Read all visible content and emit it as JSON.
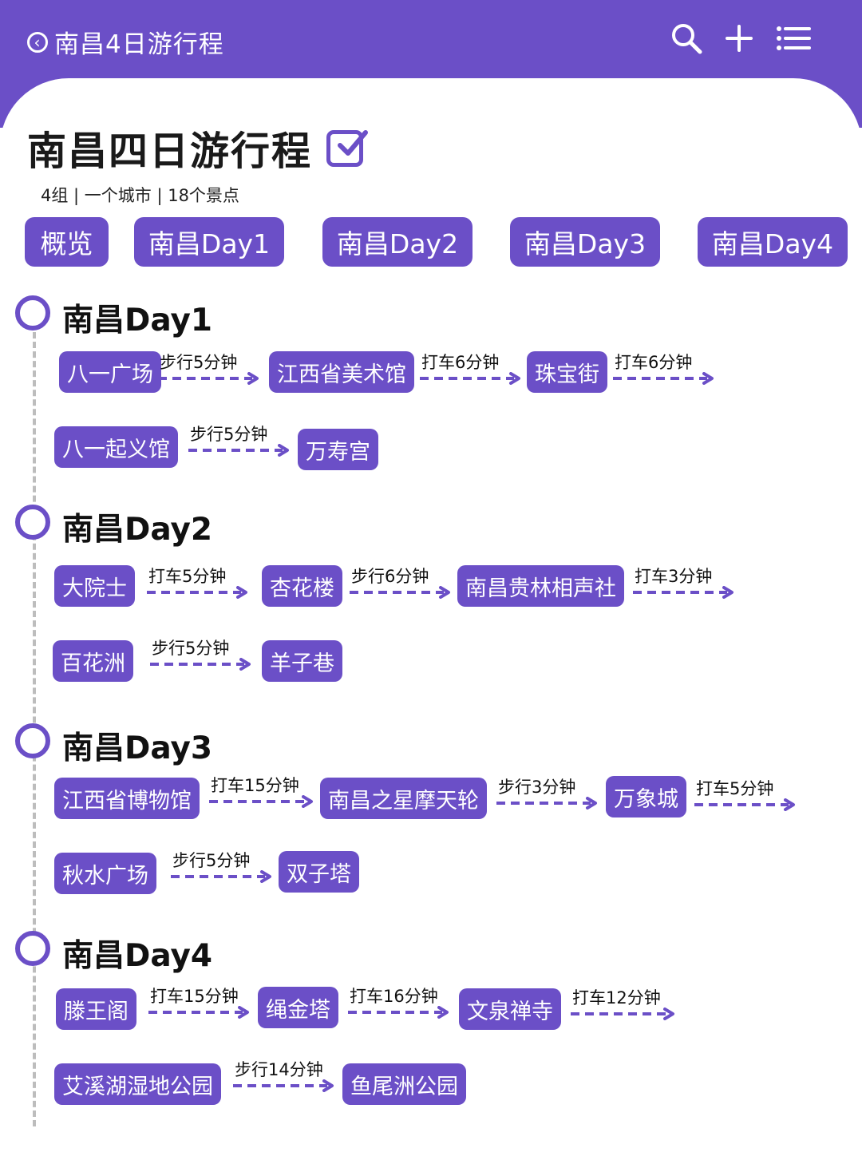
{
  "header": {
    "back_title": "南昌4日游行程",
    "icons": [
      "back-icon",
      "search-icon",
      "add-icon",
      "menu-list-icon"
    ]
  },
  "page": {
    "title": "南昌四日游行程",
    "stats": "4组 | 一个城市 | 18个景点",
    "title_icon": "checkbox-icon"
  },
  "tabs": [
    "概览",
    "南昌Day1",
    "南昌Day2",
    "南昌Day3",
    "南昌Day4"
  ],
  "days": [
    {
      "title": "南昌Day1",
      "rows": [
        [
          {
            "place": "八一广场",
            "link": "步行5分钟"
          },
          {
            "place": "江西省美术馆",
            "link": "打车6分钟"
          },
          {
            "place": "珠宝街",
            "link": "打车6分钟"
          }
        ],
        [
          {
            "place": "八一起义馆",
            "link": "步行5分钟"
          },
          {
            "place": "万寿宫",
            "link": ""
          }
        ]
      ]
    },
    {
      "title": "南昌Day2",
      "rows": [
        [
          {
            "place": "大院士",
            "link": "打车5分钟"
          },
          {
            "place": "杏花楼",
            "link": "步行6分钟"
          },
          {
            "place": "南昌贵林相声社",
            "link": "打车3分钟"
          }
        ],
        [
          {
            "place": "百花洲",
            "link": "步行5分钟"
          },
          {
            "place": "羊子巷",
            "link": ""
          }
        ]
      ]
    },
    {
      "title": "南昌Day3",
      "rows": [
        [
          {
            "place": "江西省博物馆",
            "link": "打车15分钟"
          },
          {
            "place": "南昌之星摩天轮",
            "link": "步行3分钟"
          },
          {
            "place": "万象城",
            "link": "打车5分钟"
          }
        ],
        [
          {
            "place": "秋水广场",
            "link": "步行5分钟"
          },
          {
            "place": "双子塔",
            "link": ""
          }
        ]
      ]
    },
    {
      "title": "南昌Day4",
      "rows": [
        [
          {
            "place": "滕王阁",
            "link": "打车15分钟"
          },
          {
            "place": "绳金塔",
            "link": "打车16分钟"
          },
          {
            "place": "文泉禅寺",
            "link": "打车12分钟"
          }
        ],
        [
          {
            "place": "艾溪湖湿地公园",
            "link": "步行14分钟"
          },
          {
            "place": "鱼尾洲公园",
            "link": ""
          }
        ]
      ]
    }
  ],
  "colors": {
    "accent": "#6b4fc7",
    "chip_text": "#ffffff",
    "timeline": "#bdbdbd"
  }
}
